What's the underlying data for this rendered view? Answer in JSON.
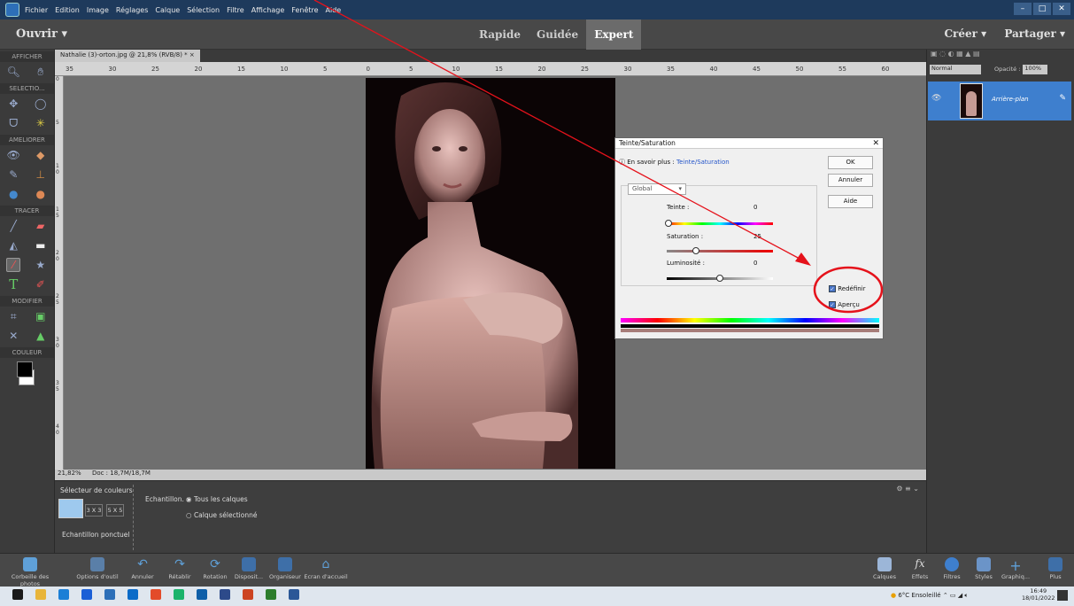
{
  "menu": [
    "Fichier",
    "Edition",
    "Image",
    "Réglages",
    "Calque",
    "Sélection",
    "Filtre",
    "Affichage",
    "Fenêtre",
    "Aide"
  ],
  "window_buttons": [
    "–",
    "□",
    "✕"
  ],
  "mode_bar": {
    "open": "Ouvrir ▾",
    "modes": [
      "Rapide",
      "Guidée",
      "Expert"
    ],
    "create": "Créer ▾",
    "share": "Partager ▾"
  },
  "toolbox": {
    "sections": [
      "AFFICHER",
      "SELECTIO...",
      "AMELIORER",
      "TRACER",
      "MODIFIER",
      "COULEUR"
    ]
  },
  "document": {
    "tab": "Nathalie (3)-orton.jpg @ 21,8% (RVB/8) * ×",
    "ruler_top": [
      "35",
      "30",
      "25",
      "20",
      "15",
      "10",
      "5",
      "0",
      "5",
      "10",
      "15",
      "20",
      "25",
      "30",
      "35",
      "40",
      "45",
      "50",
      "55",
      "60"
    ],
    "ruler_left": [
      "0",
      "5",
      "1\n0",
      "1\n5",
      "2\n0",
      "2\n5",
      "3\n0",
      "3\n5",
      "4\n0"
    ],
    "status_zoom": "21,82%",
    "status_doc": "Doc : 18,7M/18,7M"
  },
  "options": {
    "title": "Sélecteur de couleurs",
    "sizes": [
      "3 X 3",
      "5 X 5"
    ],
    "sample_label": "Echantillon ponctuel",
    "echantillon": "Echantillon. :",
    "opt1": "Tous les calques",
    "opt2": "Calque sélectionné"
  },
  "dialog": {
    "title": "Teinte/Saturation",
    "learn_prefix": "En savoir plus : ",
    "learn_link": "Teinte/Saturation",
    "preset": "Global",
    "ok": "OK",
    "cancel": "Annuler",
    "help": "Aide",
    "hue_label": "Teinte :",
    "hue_value": "0",
    "sat_label": "Saturation :",
    "sat_value": "25",
    "light_label": "Luminosité :",
    "light_value": "0",
    "redefine": "Redéfinir",
    "preview": "Aperçu"
  },
  "right_panel": {
    "blend": "Normal",
    "opacity_label": "Opacité :",
    "opacity_value": "100%",
    "layer_name": "Arrière-plan"
  },
  "bottombar": {
    "left": [
      "Corbeille des photos",
      "Options d'outil",
      "Annuler",
      "Rétablir",
      "Rotation",
      "Disposit...",
      "Organiseur",
      "Ecran d'accueil"
    ],
    "right": [
      "Calques",
      "Effets",
      "Filtres",
      "Styles",
      "Graphiq...",
      "Plus"
    ]
  },
  "taskbar": {
    "weather": "6°C Ensoleillé",
    "time": "16:49",
    "date": "18/01/2022"
  },
  "colors": {
    "annotation_red": "#e5121b",
    "accent": "#3e7fce"
  }
}
